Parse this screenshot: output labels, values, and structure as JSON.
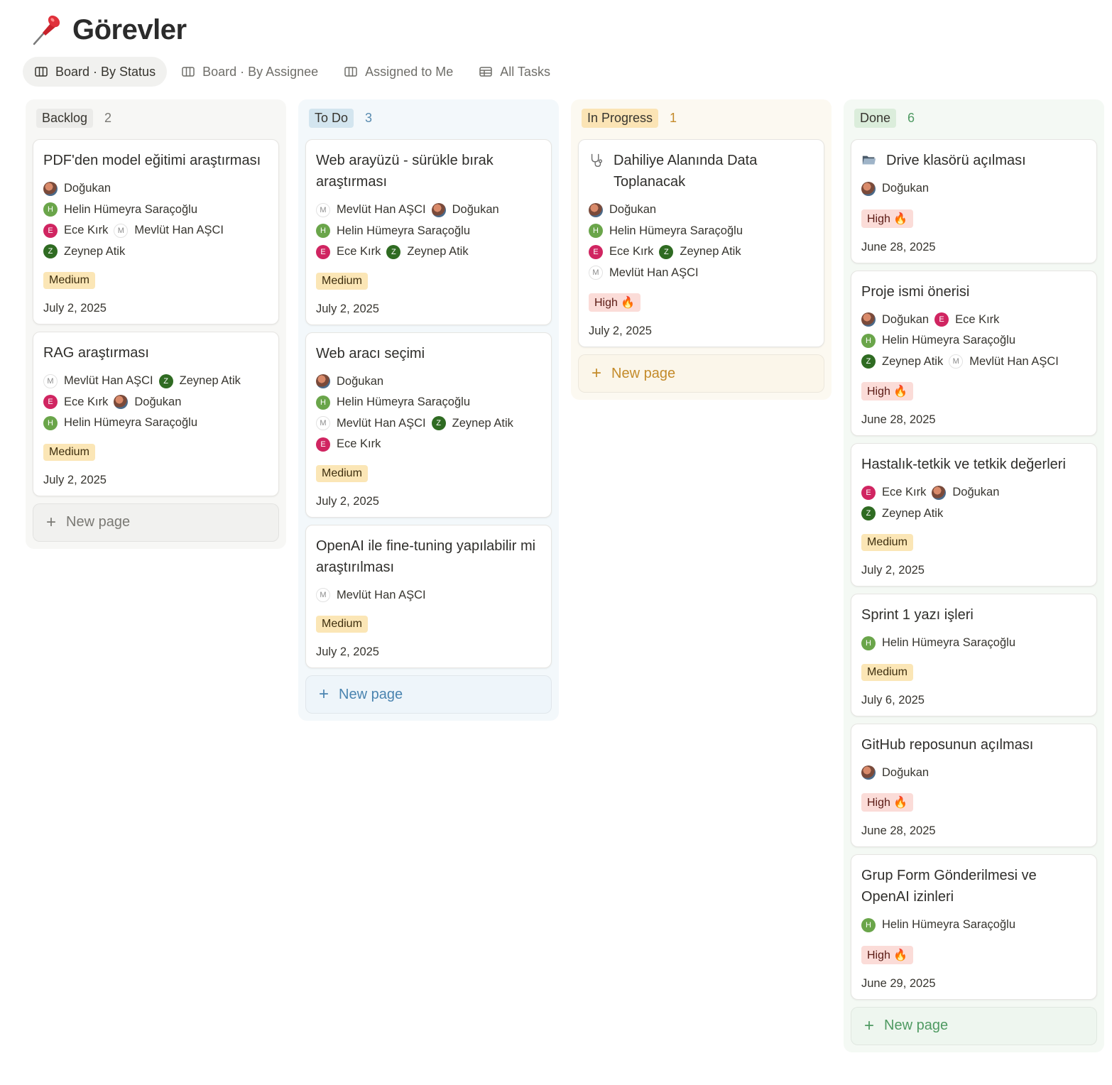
{
  "page": {
    "title": "Görevler",
    "icon": "pushpin-icon"
  },
  "tabs": [
    {
      "label": "Board · By Status",
      "icon": "board-icon",
      "active": true
    },
    {
      "label": "Board · By Assignee",
      "icon": "board-icon",
      "active": false
    },
    {
      "label": "Assigned to Me",
      "icon": "board-icon",
      "active": false
    },
    {
      "label": "All Tasks",
      "icon": "table-icon",
      "active": false
    }
  ],
  "columns": [
    {
      "name": "Backlog",
      "count": "2",
      "colors": {
        "bg": "#f7f7f5",
        "pill": "#ebebe9",
        "count": "#7a7974",
        "newpage": "#7a7974",
        "newpage_bg": "#f1f1ef"
      },
      "new_page_label": "New page",
      "cards": [
        {
          "title": "PDF'den model eğitimi araştırması",
          "people": [
            "Doğukan",
            "Helin Hümeyra Saraçoğlu",
            "Ece Kırk",
            "Mevlüt Han AŞCI",
            "Zeynep Atik"
          ],
          "priority": "Medium",
          "date": "July 2, 2025"
        },
        {
          "title": "RAG araştırması",
          "people": [
            "Mevlüt Han AŞCI",
            "Zeynep Atik",
            "Ece Kırk",
            "Doğukan",
            "Helin Hümeyra Saraçoğlu"
          ],
          "priority": "Medium",
          "date": "July 2, 2025"
        }
      ]
    },
    {
      "name": "To Do",
      "count": "3",
      "colors": {
        "bg": "#f3f8fb",
        "pill": "#d3e5ef",
        "count": "#5a8cb0",
        "newpage": "#4a84b0",
        "newpage_bg": "#eef5fa"
      },
      "new_page_label": "New page",
      "cards": [
        {
          "title": "Web arayüzü - sürükle bırak araştırması",
          "people": [
            "Mevlüt Han AŞCI",
            "Doğukan",
            "Helin Hümeyra Saraçoğlu",
            "Ece Kırk",
            "Zeynep Atik"
          ],
          "priority": "Medium",
          "date": "July 2, 2025"
        },
        {
          "title": "Web aracı seçimi",
          "people": [
            "Doğukan",
            "Helin Hümeyra Saraçoğlu",
            "Mevlüt Han AŞCI",
            "Zeynep Atik",
            "Ece Kırk"
          ],
          "priority": "Medium",
          "date": "July 2, 2025"
        },
        {
          "title": "OpenAI ile fine-tuning yapılabilir mi araştırılması",
          "people": [
            "Mevlüt Han AŞCI"
          ],
          "priority": "Medium",
          "date": "July 2, 2025"
        }
      ]
    },
    {
      "name": "In Progress",
      "count": "1",
      "colors": {
        "bg": "#fcf9f1",
        "pill": "#fbe4b5",
        "count": "#c48b2a",
        "newpage": "#c48b2a",
        "newpage_bg": "#fbf6ea"
      },
      "new_page_label": "New page",
      "cards": [
        {
          "title": "Dahiliye Alanında Data Toplanacak",
          "title_icon": "stethoscope-icon",
          "people": [
            "Doğukan",
            "Helin Hümeyra Saraçoğlu",
            "Ece Kırk",
            "Zeynep Atik",
            "Mevlüt Han AŞCI"
          ],
          "priority": "High 🔥",
          "date": "July 2, 2025"
        }
      ]
    },
    {
      "name": "Done",
      "count": "6",
      "colors": {
        "bg": "#f4f9f4",
        "pill": "#dbeddb",
        "count": "#4f9a62",
        "newpage": "#4f9a62",
        "newpage_bg": "#eef6ef"
      },
      "new_page_label": "New page",
      "cards": [
        {
          "title": "Drive klasörü açılması",
          "title_icon": "folder-icon",
          "people": [
            "Doğukan"
          ],
          "priority": "High 🔥",
          "date": "June 28, 2025"
        },
        {
          "title": "Proje ismi önerisi",
          "people": [
            "Doğukan",
            "Ece Kırk",
            "Helin Hümeyra Saraçoğlu",
            "Zeynep Atik",
            "Mevlüt Han AŞCI"
          ],
          "priority": "High 🔥",
          "date": "June 28, 2025"
        },
        {
          "title": "Hastalık-tetkik ve tetkik değerleri",
          "people": [
            "Ece Kırk",
            "Doğukan",
            "Zeynep Atik"
          ],
          "priority": "Medium",
          "date": "July 2, 2025"
        },
        {
          "title": "Sprint 1 yazı işleri",
          "people": [
            "Helin Hümeyra Saraçoğlu"
          ],
          "priority": "Medium",
          "date": "July 6, 2025"
        },
        {
          "title": "GitHub reposunun açılması",
          "people": [
            "Doğukan"
          ],
          "priority": "High 🔥",
          "date": "June 28, 2025"
        },
        {
          "title": "Grup Form Gönderilmesi ve OpenAI izinleri",
          "people": [
            "Helin Hümeyra Saraçoğlu"
          ],
          "priority": "High 🔥",
          "date": "June 29, 2025"
        }
      ]
    }
  ]
}
